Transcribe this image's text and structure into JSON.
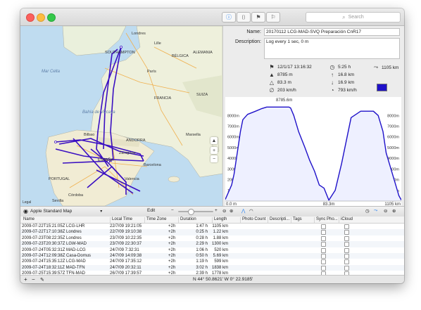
{
  "toolbar": {
    "search_placeholder": "Search",
    "icons": [
      "info-icon",
      "camera-icon",
      "flag-pair-icon",
      "flag-icon"
    ]
  },
  "map": {
    "labels": {
      "southampton": "SOUTHAMPTON",
      "london": "Londres",
      "lille": "Lille",
      "belgica": "BÉLGICA",
      "alemania": "ALEMANIA",
      "paris": "París",
      "mar_celta": "Mar Celta",
      "francia": "FRANCIA",
      "suiza": "SUIZA",
      "bahia": "Bahía de Vizcaya",
      "bilbao": "Bilbao",
      "andorra": "ANDORRA",
      "zaragoza": "Zaragoza",
      "madrid": "ESPAÑA",
      "barcelona": "Barcelona",
      "portugal": "PORTUGAL",
      "valencia": "Valencia",
      "cordoba": "Córdoba",
      "sevilla": "Sevilla",
      "marseille": "Marsella",
      "legal": "Legal"
    }
  },
  "details": {
    "name_label": "Name:",
    "name_value": "20170112 LCG-MAD-SVQ Preparación CnR17",
    "description_label": "Description:",
    "description_value": "Log every 1 sec, 0 m",
    "stats": {
      "start": "12/1/17 13:16:32",
      "duration": "5:25 h",
      "distance": "1105 km",
      "max_alt": "8785 m",
      "climb": "16.8 km",
      "min_alt": "83.3 m",
      "descent": "16.9 km",
      "avg_speed": "203 km/h",
      "max_speed": "793 km/h"
    },
    "track_color": "#1f11c9"
  },
  "chart_data": {
    "type": "area",
    "x": [
      0,
      40,
      55,
      75,
      95,
      110,
      140,
      190,
      230,
      260,
      300,
      340,
      380,
      400,
      410,
      430,
      460,
      500,
      530,
      560,
      590,
      620,
      650,
      690,
      730,
      790,
      850,
      890,
      930,
      960,
      990,
      1010,
      1040,
      1070,
      1090,
      1105
    ],
    "y": [
      150,
      1500,
      2500,
      4500,
      6500,
      7600,
      8100,
      8400,
      8650,
      8785,
      8785,
      8785,
      8785,
      8785,
      8700,
      8000,
      6500,
      5000,
      3800,
      2800,
      1500,
      1200,
      83.3,
      1000,
      3500,
      7800,
      8400,
      8400,
      8400,
      8000,
      6500,
      4500,
      3000,
      1500,
      500,
      100
    ],
    "series": [
      {
        "name": "",
        "color": "#1f11c9"
      }
    ],
    "annotations": {
      "max": "8785.6m",
      "min": "83.3m",
      "x_start": "0.0 m",
      "x_end": "1105 km"
    },
    "ylim": [
      0,
      9200
    ],
    "xlim": [
      0,
      1105
    ],
    "yticks": [
      "1000m",
      "2000m",
      "3000m",
      "4000m",
      "5000m",
      "6000m",
      "7000m",
      "8000m"
    ],
    "xlabel": "",
    "ylabel": "",
    "grid": false
  },
  "bottombar": {
    "map_type": "Apple Standard Map",
    "edit_label": "Edit",
    "coordinates": "N 44° 50.8621'  W 0° 22.9185'"
  },
  "table": {
    "headers": [
      "Name",
      "Local Time",
      "Time Zone",
      "Duration",
      "Length",
      "Photo Count",
      "Descripti...",
      "Tags",
      "Sync Pho...",
      "iCloud"
    ],
    "rows": [
      [
        "2009-07-22T15:21:05Z LCG-LHR",
        "22/7/09 19:21:05",
        "+2h",
        "1:47 h",
        "1105 km"
      ],
      [
        "2009-07-22T17:10:38Z Londres",
        "22/7/09 19:10:38",
        "+2h",
        "0:25 h",
        "1.22 km"
      ],
      [
        "2009-07-23T08:22:35Z Londres",
        "23/7/09 10:22:35",
        "+2h",
        "0:28 h",
        "1.88 km"
      ],
      [
        "2009-07-23T20:30:37Z LGW-MAD",
        "23/7/09 22:30:37",
        "+2h",
        "2:29 h",
        "1300 km"
      ],
      [
        "2009-07-24T05:32:31Z MAD-LCG",
        "24/7/09 7:32:31",
        "+2h",
        "1:06 h",
        "520 km"
      ],
      [
        "2009-07-24T12:09:38Z Casa-Domus",
        "24/7/09 14:09:38",
        "+2h",
        "0:50 h",
        "5.69 km"
      ],
      [
        "2009-07-24T15:35:12Z LCG-MAD",
        "24/7/09 17:35:12",
        "+2h",
        "1:19 h",
        "599 km"
      ],
      [
        "2009-07-24T18:32:11Z MAD-TFN",
        "24/7/09 20:32:11",
        "+2h",
        "3:02 h",
        "1838 km"
      ],
      [
        "2009-07-25T15:39:57Z TFN-MAD",
        "26/7/09 17:39:57",
        "+2h",
        "2:39 h",
        "1778 km"
      ]
    ]
  }
}
